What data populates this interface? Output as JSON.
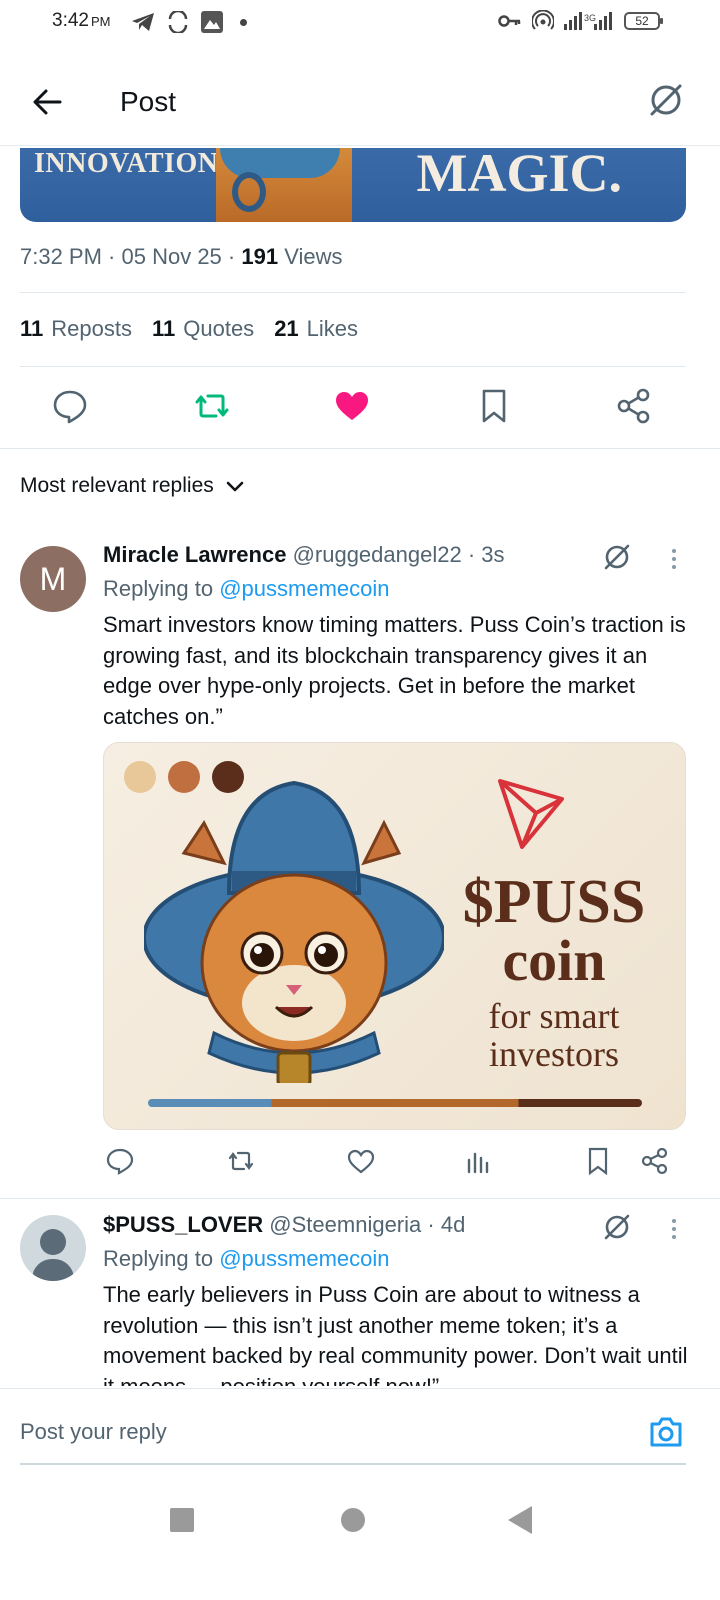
{
  "status_bar": {
    "time": "3:42",
    "ampm": "PM",
    "network": "3G",
    "battery": "52"
  },
  "header": {
    "title": "Post"
  },
  "banner": {
    "left_text": "INNOVATION",
    "right_text": "MAGIC."
  },
  "post": {
    "time": "7:32 PM",
    "date": "05 Nov 25",
    "views_count": "191",
    "views_label": "Views",
    "reposts_count": "11",
    "reposts_label": "Reposts",
    "quotes_count": "11",
    "quotes_label": "Quotes",
    "likes_count": "21",
    "likes_label": "Likes"
  },
  "sort": {
    "label": "Most relevant replies"
  },
  "replies": [
    {
      "avatar_letter": "M",
      "name": "Miracle Lawrence",
      "handle": "@ruggedangel22",
      "time": "3s",
      "replying_prefix": "Replying to",
      "replying_to": "@pussmemecoin",
      "text": "Smart investors know timing matters. Puss Coin’s traction is growing fast, and its blockchain transparency gives it an edge over hype-only projects. Get in before the market catches on.”",
      "image": {
        "title_line1": "$PUSS",
        "title_line2": "coin",
        "title_line3": "for smart",
        "title_line4": "investors"
      }
    },
    {
      "name": "$PUSS_LOVER",
      "handle": "@Steemnigeria",
      "time": "4d",
      "replying_prefix": "Replying to",
      "replying_to": "@pussmemecoin",
      "text": "The early believers in Puss Coin are about to witness a revolution — this isn’t just another meme token; it’s a movement backed by real community power. Don’t wait until it moons — position yourself now!”"
    }
  ],
  "composer": {
    "placeholder": "Post your reply"
  },
  "colors": {
    "accent": "#1d9bf0",
    "like": "#f91880",
    "repost": "#00ba7c",
    "muted": "#536471"
  },
  "icons": {
    "back": "arrow-left-icon",
    "grok": "grok-icon",
    "reply": "comment-icon",
    "repost": "repost-icon",
    "like": "heart-icon",
    "bookmark": "bookmark-icon",
    "share": "share-icon",
    "views": "bar-chart-icon",
    "camera": "camera-icon"
  }
}
